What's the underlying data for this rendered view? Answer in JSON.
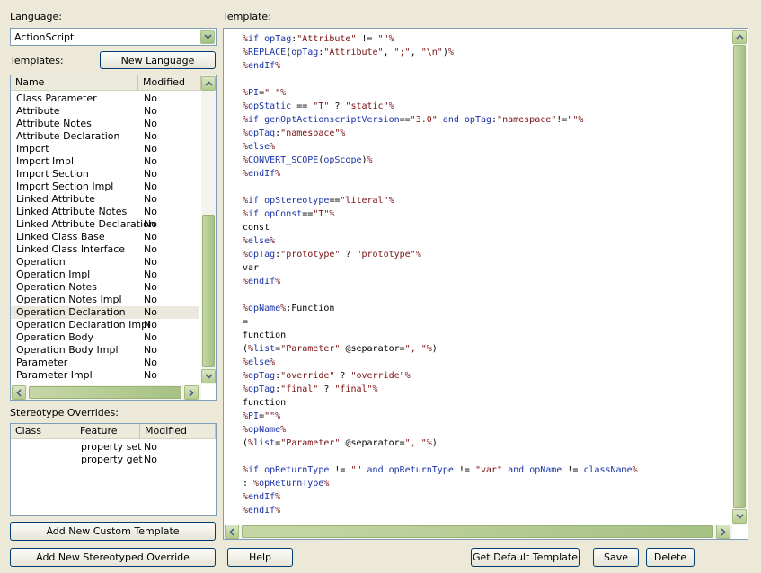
{
  "language_label": "Language:",
  "language_value": "ActionScript",
  "templates_label": "Templates:",
  "new_language_button": "New Language",
  "templates_table": {
    "headers": [
      "Name",
      "Modified"
    ],
    "rows": [
      [
        "Class Parameter",
        "No"
      ],
      [
        "Attribute",
        "No"
      ],
      [
        "Attribute Notes",
        "No"
      ],
      [
        "Attribute Declaration",
        "No"
      ],
      [
        "Import",
        "No"
      ],
      [
        "Import Impl",
        "No"
      ],
      [
        "Import Section",
        "No"
      ],
      [
        "Import Section Impl",
        "No"
      ],
      [
        "Linked Attribute",
        "No"
      ],
      [
        "Linked Attribute Notes",
        "No"
      ],
      [
        "Linked Attribute Declaration",
        "No"
      ],
      [
        "Linked Class Base",
        "No"
      ],
      [
        "Linked Class Interface",
        "No"
      ],
      [
        "Operation",
        "No"
      ],
      [
        "Operation Impl",
        "No"
      ],
      [
        "Operation Notes",
        "No"
      ],
      [
        "Operation Notes Impl",
        "No"
      ],
      [
        "Operation Declaration",
        "No"
      ],
      [
        "Operation Declaration Impl",
        "No"
      ],
      [
        "Operation Body",
        "No"
      ],
      [
        "Operation Body Impl",
        "No"
      ],
      [
        "Parameter",
        "No"
      ],
      [
        "Parameter Impl",
        "No"
      ]
    ],
    "selected_index": 17
  },
  "stereotype_label": "Stereotype Overrides:",
  "stereotype_table": {
    "headers": [
      "Class",
      "Feature",
      "Modified"
    ],
    "rows": [
      [
        "",
        "property set",
        "No"
      ],
      [
        "",
        "property get",
        "No"
      ]
    ]
  },
  "add_custom_template_button": "Add New Custom Template",
  "add_stereotyped_override_button": "Add New Stereotyped Override",
  "help_button": "Help",
  "template_label": "Template:",
  "get_default_template_button": "Get Default Template",
  "save_button": "Save",
  "delete_button": "Delete",
  "code_lines": [
    "%if opTag:\"Attribute\" != \"\"%",
    "%REPLACE(opTag:\"Attribute\", \";\", \"\\n\")%",
    "%endIf%",
    "",
    "%PI=\" \"%",
    "%opStatic == \"T\" ? \"static\"%",
    "%if genOptActionscriptVersion==\"3.0\" and opTag:\"namespace\"!=\"\"%",
    "%opTag:\"namespace\"%",
    "%else%",
    "%CONVERT_SCOPE(opScope)%",
    "%endIf%",
    "",
    "%if opStereotype==\"literal\"%",
    "%if opConst==\"T\"%",
    "const",
    "%else%",
    "%opTag:\"prototype\" ? \"prototype\"%",
    "var",
    "%endIf%",
    "",
    "%opName%:Function",
    "=",
    "function",
    "(%list=\"Parameter\" @separator=\", \"%)",
    "%else%",
    "%opTag:\"override\" ? \"override\"%",
    "%opTag:\"final\" ? \"final\"%",
    "function",
    "%PI=\"\"%",
    "%opName%",
    "(%list=\"Parameter\" @separator=\", \"%)",
    "",
    "%if opReturnType != \"\" and opReturnType != \"var\" and opName != className%",
    ": %opReturnType%",
    "%endIf%",
    "%endIf%"
  ]
}
